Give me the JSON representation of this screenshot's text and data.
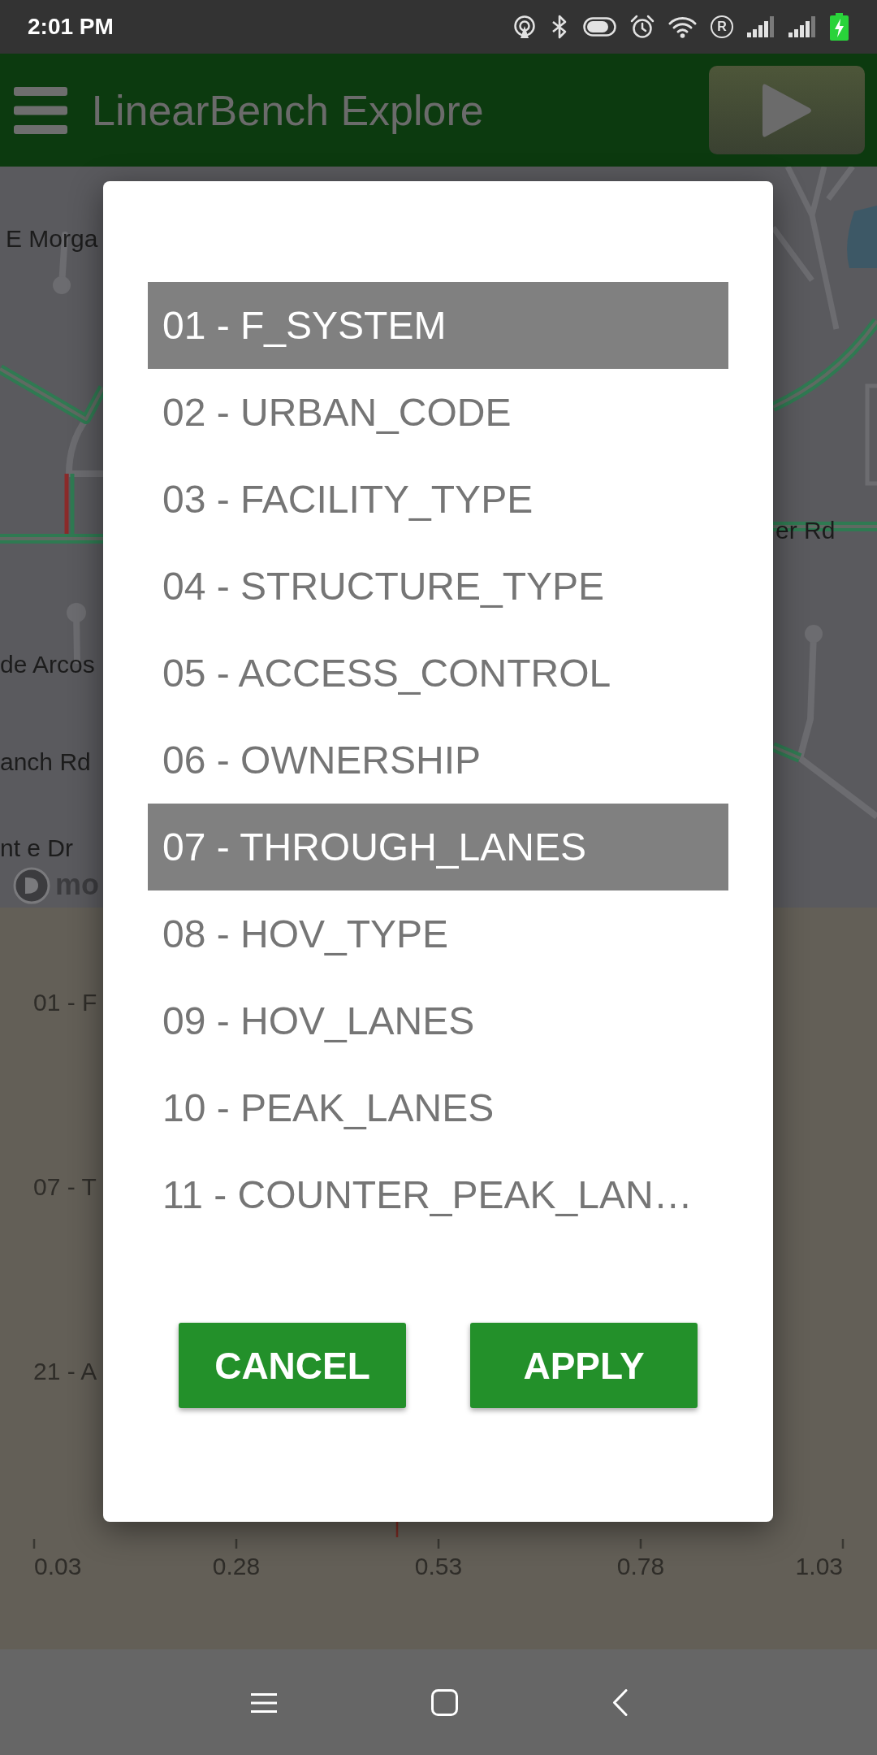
{
  "status_bar": {
    "time": "2:01 PM",
    "roaming": "R"
  },
  "app_bar": {
    "title": "LinearBench Explore"
  },
  "map": {
    "labels": [
      "E Morga",
      "er Rd",
      "de Arcos",
      "anch Rd",
      "nt e Dr"
    ],
    "attribution": "mo"
  },
  "chart": {
    "row_labels": [
      "01 - F",
      "07 - T",
      "21 - A"
    ],
    "tick_labels": [
      "0.03",
      "0.28",
      "0.53",
      "0.78",
      "1.03"
    ]
  },
  "dialog": {
    "items": [
      {
        "label": "01 - F_SYSTEM",
        "selected": true
      },
      {
        "label": "02 - URBAN_CODE",
        "selected": false
      },
      {
        "label": "03 - FACILITY_TYPE",
        "selected": false
      },
      {
        "label": "04 - STRUCTURE_TYPE",
        "selected": false
      },
      {
        "label": "05 - ACCESS_CONTROL",
        "selected": false
      },
      {
        "label": "06 - OWNERSHIP",
        "selected": false
      },
      {
        "label": "07 - THROUGH_LANES",
        "selected": true
      },
      {
        "label": "08 - HOV_TYPE",
        "selected": false
      },
      {
        "label": "09 - HOV_LANES",
        "selected": false
      },
      {
        "label": "10 - PEAK_LANES",
        "selected": false
      },
      {
        "label": "11 - COUNTER_PEAK_LAN…",
        "selected": false
      }
    ],
    "buttons": [
      "CANCEL",
      "APPLY"
    ]
  }
}
